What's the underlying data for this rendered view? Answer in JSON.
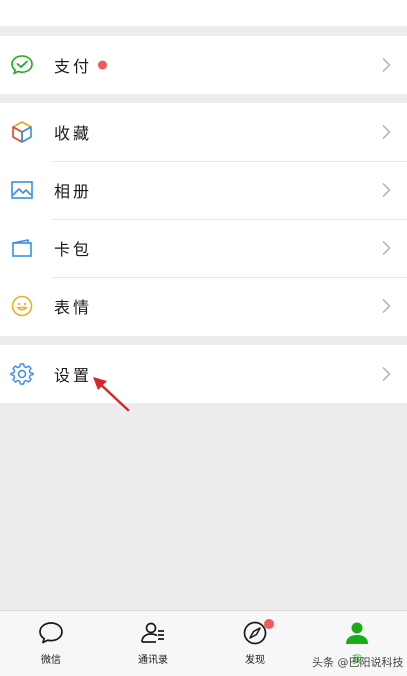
{
  "menu": {
    "pay": {
      "label": "支付",
      "icon": "wechat-pay-icon",
      "has_badge": true
    },
    "favorites": {
      "label": "收藏",
      "icon": "favorites-cube-icon"
    },
    "album": {
      "label": "相册",
      "icon": "album-picture-icon"
    },
    "cards": {
      "label": "卡包",
      "icon": "card-wallet-icon"
    },
    "stickers": {
      "label": "表情",
      "icon": "smiley-icon"
    },
    "settings": {
      "label": "设置",
      "icon": "gear-icon"
    }
  },
  "tabbar": {
    "tabs": [
      {
        "label": "微信",
        "icon": "chat-bubble-icon",
        "active": false
      },
      {
        "label": "通讯录",
        "icon": "contacts-icon",
        "active": false
      },
      {
        "label": "发现",
        "icon": "compass-icon",
        "active": false,
        "badge": true
      },
      {
        "label": "我",
        "icon": "person-icon",
        "active": true
      }
    ]
  },
  "watermark": "头条 @巴阳说科技",
  "colors": {
    "accent_green": "#1aad19",
    "badge_red": "#f05a5a",
    "arrow_red": "#d9252a",
    "background": "#ededed"
  }
}
